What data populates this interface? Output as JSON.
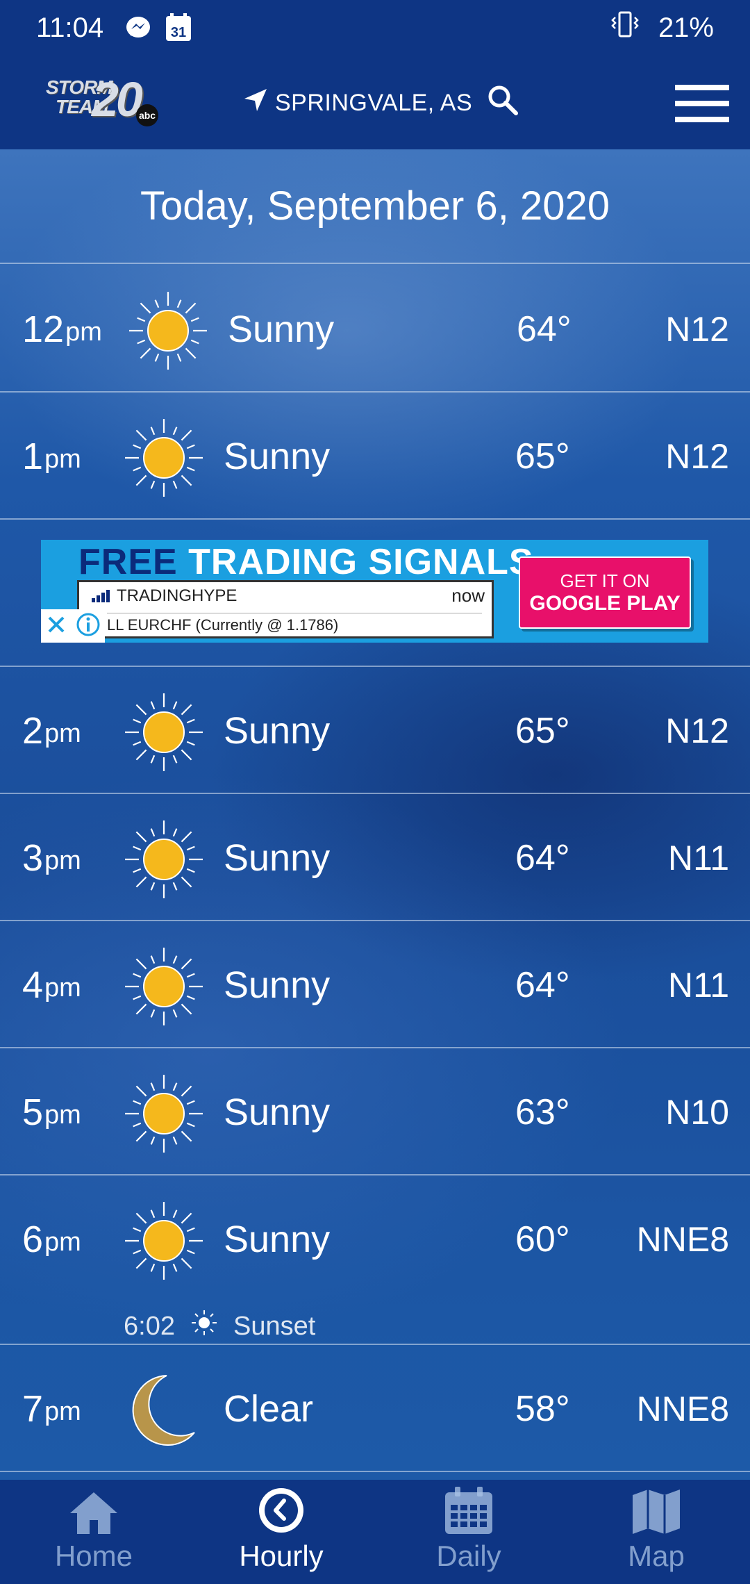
{
  "status_bar": {
    "time": "11:04",
    "calendar_day": "31",
    "battery": "21%"
  },
  "app_bar": {
    "logo_line1": "STORM",
    "logo_line2": "TEAM",
    "logo_number": "20",
    "logo_network": "abc",
    "location": "SPRINGVALE, AS"
  },
  "date_header": "Today, September 6, 2020",
  "hours": [
    {
      "hour": "12",
      "ampm": "pm",
      "icon": "sun-icon",
      "condition": "Sunny",
      "temp": "64°",
      "wind": "N12"
    },
    {
      "hour": "1",
      "ampm": "pm",
      "icon": "sun-icon",
      "condition": "Sunny",
      "temp": "65°",
      "wind": "N12"
    },
    {
      "hour": "2",
      "ampm": "pm",
      "icon": "sun-icon",
      "condition": "Sunny",
      "temp": "65°",
      "wind": "N12"
    },
    {
      "hour": "3",
      "ampm": "pm",
      "icon": "sun-icon",
      "condition": "Sunny",
      "temp": "64°",
      "wind": "N11"
    },
    {
      "hour": "4",
      "ampm": "pm",
      "icon": "sun-icon",
      "condition": "Sunny",
      "temp": "64°",
      "wind": "N11"
    },
    {
      "hour": "5",
      "ampm": "pm",
      "icon": "sun-icon",
      "condition": "Sunny",
      "temp": "63°",
      "wind": "N10"
    },
    {
      "hour": "6",
      "ampm": "pm",
      "icon": "sun-icon",
      "condition": "Sunny",
      "temp": "60°",
      "wind": "NNE8"
    },
    {
      "hour": "7",
      "ampm": "pm",
      "icon": "moon-icon",
      "condition": "Clear",
      "temp": "58°",
      "wind": "NNE8"
    }
  ],
  "sunset": {
    "time": "6:02",
    "label": "Sunset"
  },
  "ad": {
    "headline_free": "FREE",
    "headline_rest": "TRADING SIGNALS",
    "notif_brand": "TRADINGHYPE",
    "notif_time": "now",
    "notif_text": "LL EURCHF (Currently @ 1.1786)",
    "cta_line1": "GET IT ON",
    "cta_line2": "GOOGLE PLAY"
  },
  "bottom_nav": [
    {
      "label": "Home",
      "icon": "home-icon",
      "active": false
    },
    {
      "label": "Hourly",
      "icon": "clock-icon",
      "active": true
    },
    {
      "label": "Daily",
      "icon": "calendar-icon",
      "active": false
    },
    {
      "label": "Map",
      "icon": "map-icon",
      "active": false
    }
  ],
  "colors": {
    "header_blue": "#0e3584",
    "sun_yellow": "#f5b81c",
    "moon_gold": "#b8954a",
    "ad_pink": "#e8106a",
    "ad_blue": "#1b9fe0"
  }
}
